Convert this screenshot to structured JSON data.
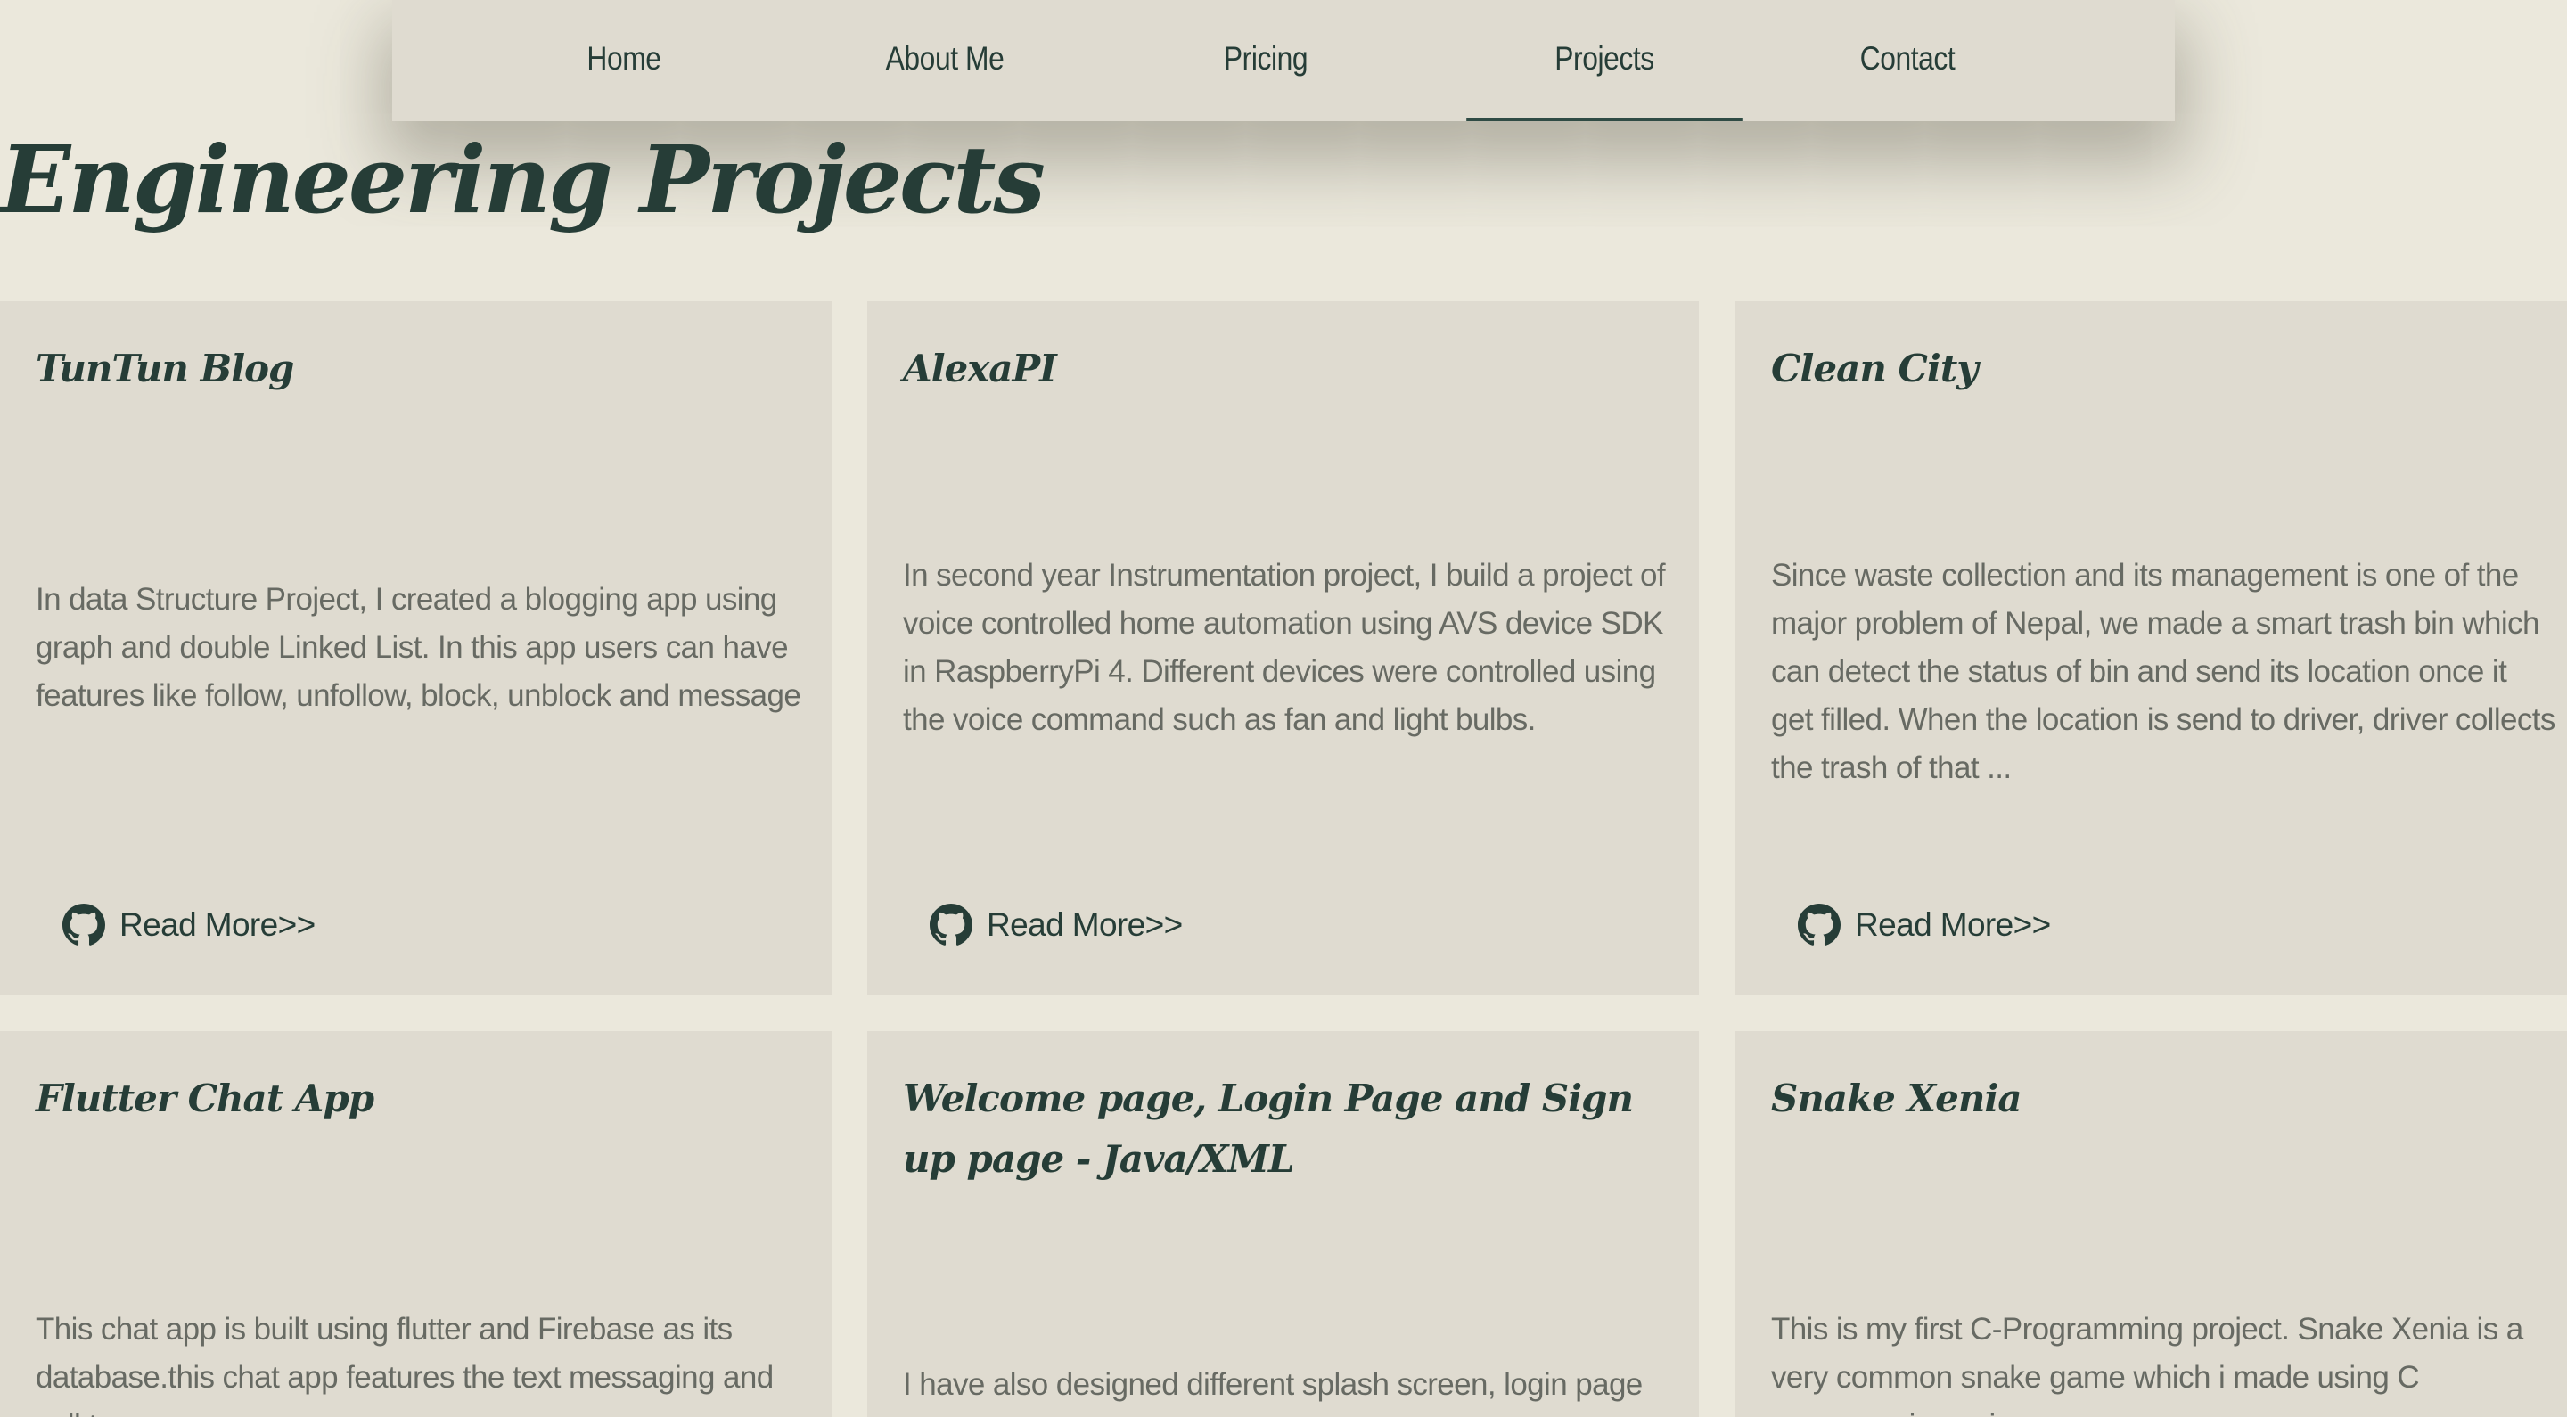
{
  "nav": {
    "items": [
      {
        "label": "Home"
      },
      {
        "label": "About Me"
      },
      {
        "label": "Pricing"
      },
      {
        "label": "Projects",
        "active": true
      },
      {
        "label": "Contact"
      }
    ]
  },
  "page": {
    "title": "Engineering Projects"
  },
  "projects": [
    {
      "title": "TunTun Blog",
      "description": "In data Structure Project, I created a blogging app using graph and double Linked List. In this app users can have features like follow, unfollow, block, unblock and message",
      "link_label": "Read More>>",
      "icon": "github-icon"
    },
    {
      "title": "AlexaPI",
      "description": "In second year Instrumentation project, I build a project of voice controlled home automation using AVS device SDK in RaspberryPi 4. Different devices were controlled using the voice command such as fan and light bulbs.",
      "link_label": "Read More>>",
      "icon": "github-icon"
    },
    {
      "title": "Clean City",
      "description": "Since waste collection and its management is one of the major problem of Nepal, we made a smart trash bin which can detect the status of bin and send its location once it get filled. When the location is send to driver, driver collects the trash of that ...",
      "link_label": "Read More>>",
      "icon": "github-icon"
    },
    {
      "title": "Flutter Chat App",
      "description": "This chat app is built using flutter and Firebase as its database.this chat app features the text messaging and call to",
      "icon": "github-icon"
    },
    {
      "title": "Welcome page, Login Page and Sign up page - Java/XML",
      "description": "I have also designed different splash screen, login page and",
      "icon": "github-icon"
    },
    {
      "title": "Snake Xenia",
      "description": "This is my first C-Programming project. Snake Xenia is a very common snake game which i made using C programming using",
      "icon": "github-icon"
    }
  ],
  "colors": {
    "background": "#ebe8dc",
    "card": "#dfdbd0",
    "accent": "#263d37",
    "body_text": "#676a63"
  }
}
